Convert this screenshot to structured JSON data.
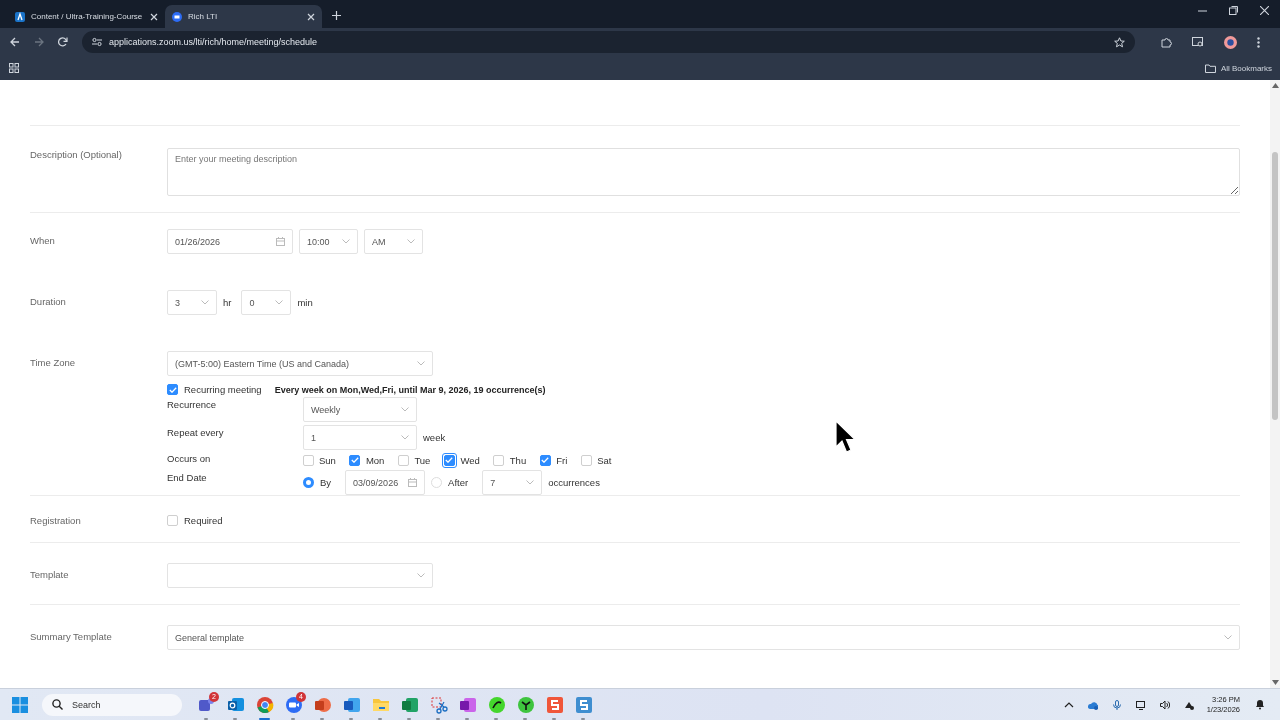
{
  "browser": {
    "tabs": [
      {
        "title": "Content / Ultra-Training-Course",
        "selected": false,
        "kind": "learn"
      },
      {
        "title": "Rich LTI",
        "selected": true,
        "kind": "zoom"
      }
    ],
    "url": "applications.zoom.us/lti/rich/home/meeting/schedule",
    "bookmarks_label": "All Bookmarks"
  },
  "form": {
    "description": {
      "label": "Description (Optional)",
      "placeholder": "Enter your meeting description"
    },
    "when": {
      "label": "When",
      "date": "01/26/2026",
      "time": "10:00",
      "period": "AM"
    },
    "duration": {
      "label": "Duration",
      "hours": "3",
      "hours_unit": "hr",
      "minutes": "0",
      "minutes_unit": "min"
    },
    "time_zone": {
      "label": "Time Zone",
      "value": "(GMT-5:00) Eastern Time (US and Canada)"
    },
    "recurring": {
      "label": "Recurring meeting",
      "checked": true,
      "summary": "Every week on Mon,Wed,Fri, until Mar 9, 2026, 19 occurrence(s)",
      "recurrence_label": "Recurrence",
      "recurrence_value": "Weekly",
      "repeat_label": "Repeat every",
      "repeat_value": "1",
      "repeat_unit": "week",
      "occurs_label": "Occurs on",
      "days": [
        {
          "label": "Sun",
          "checked": false,
          "focused": false
        },
        {
          "label": "Mon",
          "checked": true,
          "focused": false
        },
        {
          "label": "Tue",
          "checked": false,
          "focused": false
        },
        {
          "label": "Wed",
          "checked": true,
          "focused": true
        },
        {
          "label": "Thu",
          "checked": false,
          "focused": false
        },
        {
          "label": "Fri",
          "checked": true,
          "focused": false
        },
        {
          "label": "Sat",
          "checked": false,
          "focused": false
        }
      ],
      "end_label": "End Date",
      "end_options": [
        {
          "kind": "date",
          "label": "By",
          "selected": true,
          "value": "03/09/2026"
        },
        {
          "kind": "count",
          "label": "After",
          "selected": false,
          "value": "7",
          "unit": "occurrences"
        }
      ]
    },
    "registration": {
      "label": "Registration",
      "option": "Required",
      "checked": false
    },
    "template": {
      "label": "Template"
    },
    "summary_template": {
      "label": "Summary Template",
      "value": "General template"
    }
  },
  "taskbar": {
    "search_placeholder": "Search",
    "apps": [
      {
        "kind": "teams",
        "badge": "2",
        "active": false
      },
      {
        "kind": "outlook",
        "active": false
      },
      {
        "kind": "chrome",
        "active": true
      },
      {
        "kind": "zoom",
        "badge": "4",
        "active": false
      },
      {
        "kind": "powerpoint",
        "active": false
      },
      {
        "kind": "word",
        "active": false
      },
      {
        "kind": "folder",
        "active": false
      },
      {
        "kind": "excel",
        "active": false
      },
      {
        "kind": "snip",
        "active": false
      },
      {
        "kind": "onenote",
        "active": false
      },
      {
        "kind": "razer",
        "active": false
      },
      {
        "kind": "green",
        "active": false
      },
      {
        "kind": "red-s",
        "active": false
      },
      {
        "kind": "blue-s",
        "active": false
      }
    ],
    "time": "3:26 PM",
    "date": "1/23/2026"
  }
}
